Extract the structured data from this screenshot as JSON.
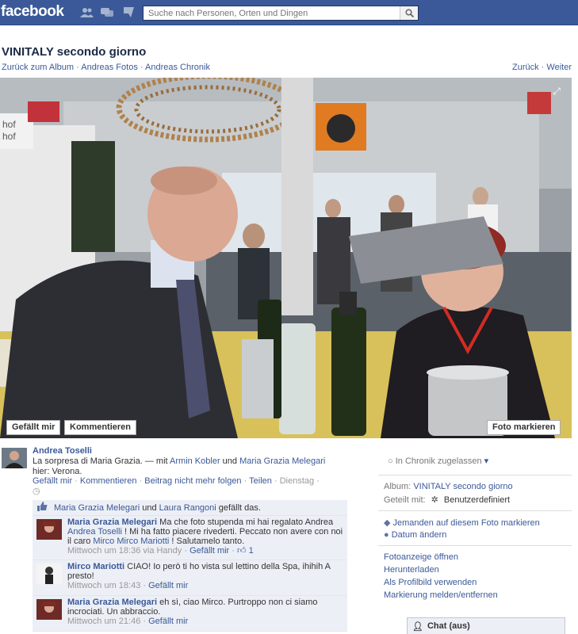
{
  "topbar": {
    "logo": "facebook",
    "search_placeholder": "Suche nach Personen, Orten und Dingen",
    "jewels": [
      "friends-icon",
      "messages-icon",
      "notifications-icon"
    ]
  },
  "album": {
    "title": "VINITALY secondo giorno",
    "crumbs": [
      "Zurück zum Album",
      "Andreas Fotos",
      "Andreas Chronik"
    ],
    "nav": [
      "Zurück",
      "Weiter"
    ]
  },
  "photo": {
    "like_label": "Gefällt mir",
    "comment_label": "Kommentieren",
    "tag_label": "Foto markieren",
    "signs": [
      "hof",
      "hof"
    ]
  },
  "post": {
    "author": "Andrea Toselli",
    "text": "La sorpresa di Maria Grazia.",
    "with_prefix": "— mit",
    "tag1": "Armin Kobler",
    "and": "und",
    "tag2": "Maria Grazia Melegari",
    "here": "hier: Verona.",
    "actions": [
      "Gefällt mir",
      "Kommentieren",
      "Beitrag nicht mehr folgen",
      "Teilen"
    ],
    "time": "Dienstag"
  },
  "likes": {
    "user1": "Maria Grazia Melegari",
    "and": "und",
    "user2": "Laura Rangoni",
    "suffix": "gefällt das."
  },
  "comments": [
    {
      "name": "Maria Grazia Melegari",
      "text_a": "Ma che foto stupenda mi hai regalato Andrea",
      "link1": "Andrea Toselli",
      "text_b": "! Mi ha fatto piacere rivederti. Peccato non avere con noi il caro",
      "link2": "Mirco Mirco Mariotti",
      "text_c": "! Salutamelo tanto.",
      "time": "Mittwoch um 18:36 via Handy",
      "like": "Gefällt mir",
      "like_count": "1"
    },
    {
      "name": "Mirco Mariotti",
      "text": "CIAO! Io però ti ho vista sul lettino della Spa, ihihih A presto!",
      "time": "Mittwoch um 18:43",
      "like": "Gefällt mir"
    },
    {
      "name": "Maria Grazia Melegari",
      "text": "eh sì, ciao Mirco. Purtroppo non ci siamo incrociati. Un abbraccio.",
      "time": "Mittwoch um 21:46",
      "like": "Gefällt mir"
    }
  ],
  "sidebar": {
    "chronik": "In Chronik zugelassen",
    "album_label": "Album:",
    "album_value": "VINITALY secondo giorno",
    "shared_label": "Geteilt mit:",
    "shared_value": "Benutzerdefiniert",
    "tag_person": "Jemanden auf diesem Foto markieren",
    "change_date": "Datum ändern",
    "links": [
      "Fotoanzeige öffnen",
      "Herunterladen",
      "Als Profilbild verwenden",
      "Markierung melden/entfernen"
    ]
  },
  "chat": {
    "label": "Chat (aus)"
  },
  "colors": {
    "brand": "#3b5998",
    "link": "#3b5998",
    "comment_bg": "#eceff5"
  }
}
